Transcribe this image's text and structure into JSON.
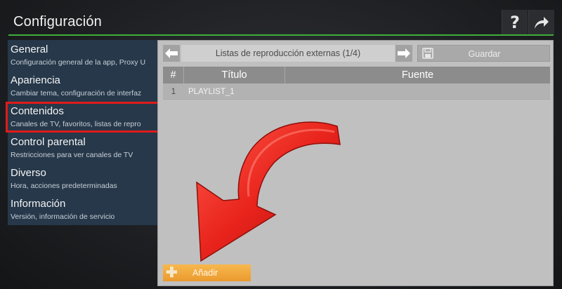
{
  "header": {
    "title": "Configuración",
    "help_glyph": "?",
    "accent_color": "#3fae3a"
  },
  "sidebar": {
    "items": [
      {
        "label": "General",
        "description": "Configuración general de la app, Proxy U"
      },
      {
        "label": "Apariencia",
        "description": "Cambiar tema, configuración de interfaz"
      },
      {
        "label": "Contenidos",
        "description": "Canales de TV, favoritos, listas de repro",
        "selected": true
      },
      {
        "label": "Control parental",
        "description": "Restricciones para ver canales de TV"
      },
      {
        "label": "Diverso",
        "description": "Hora, acciones predeterminadas"
      },
      {
        "label": "Información",
        "description": "Versión, información de servicio"
      }
    ],
    "highlight_color": "#e01b1b"
  },
  "toolbar": {
    "list_title": "Listas de reproducción externas (1/4)",
    "save_label": "Guardar",
    "prev_icon": "arrow-left-icon",
    "next_icon": "arrow-right-icon",
    "save_icon": "floppy-disk-icon"
  },
  "table": {
    "columns": [
      "#",
      "Título",
      "Fuente"
    ],
    "rows": [
      {
        "index": "1",
        "title": "PLAYLIST_1",
        "source": ""
      }
    ]
  },
  "add_button": {
    "label": "Añadir",
    "icon": "plus-icon",
    "color": "#f0a73a"
  },
  "annotation": {
    "icon": "red-curved-arrow-icon",
    "color": "#e8231c"
  }
}
